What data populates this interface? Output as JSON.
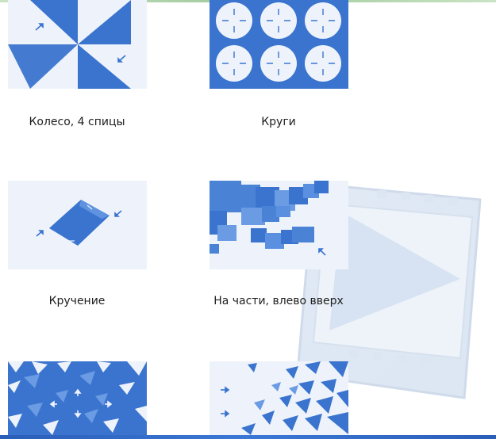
{
  "transitions": [
    {
      "label": "Колесо, 4 спицы",
      "icon": "pinwheel-transition-icon"
    },
    {
      "label": "Круги",
      "icon": "circles-transition-icon"
    },
    {
      "label": "Кручение",
      "icon": "twist-transition-icon"
    },
    {
      "label": "На части, влево вверх",
      "icon": "shatter-up-left-transition-icon"
    },
    {
      "label": "",
      "icon": "shatter-in-transition-icon"
    },
    {
      "label": "",
      "icon": "shatter-right-transition-icon"
    }
  ],
  "colors": {
    "accent": "#3a74cf",
    "accent_dark": "#1f52a8",
    "tile_bg": "#eef3fb",
    "text": "#1e1e1e"
  }
}
